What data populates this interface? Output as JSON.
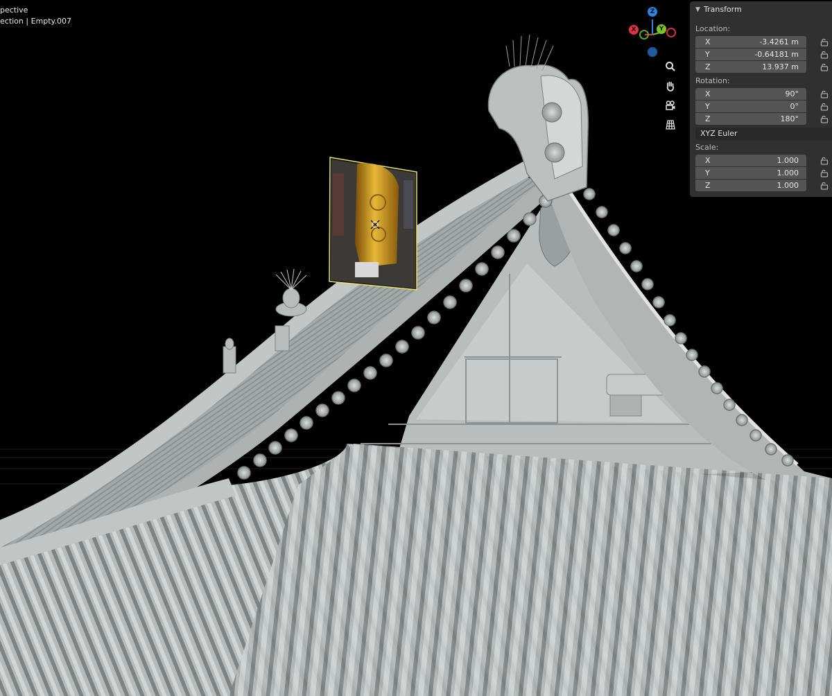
{
  "viewport": {
    "line1": "pective",
    "line2": "ection | Empty.007"
  },
  "gizmo": {
    "x": "X",
    "y": "Y",
    "z": "Z",
    "x_color": "#e0334a",
    "y_color": "#7bc421",
    "z_color": "#2f83e0"
  },
  "nav_icons": [
    "zoom-icon",
    "hand-pan-icon",
    "camera-icon",
    "grid-icon"
  ],
  "panel": {
    "title": "Transform",
    "location": {
      "label": "Location:",
      "x": {
        "axis": "X",
        "value": "-3.4261 m"
      },
      "y": {
        "axis": "Y",
        "value": "-0.64181 m"
      },
      "z": {
        "axis": "Z",
        "value": "13.937 m"
      }
    },
    "rotation": {
      "label": "Rotation:",
      "x": {
        "axis": "X",
        "value": "90°"
      },
      "y": {
        "axis": "Y",
        "value": "0°"
      },
      "z": {
        "axis": "Z",
        "value": "180°"
      }
    },
    "rotation_mode": "XYZ Euler",
    "scale": {
      "label": "Scale:",
      "x": {
        "axis": "X",
        "value": "1.000"
      },
      "y": {
        "axis": "Y",
        "value": "1.000"
      },
      "z": {
        "axis": "Z",
        "value": "1.000"
      }
    }
  },
  "colors": {
    "panel_bg": "#303030",
    "field_bg": "#545454",
    "selection_outline": "#e6e066",
    "reference_gold": "#c9951c",
    "roof_base": "#8f9594"
  }
}
